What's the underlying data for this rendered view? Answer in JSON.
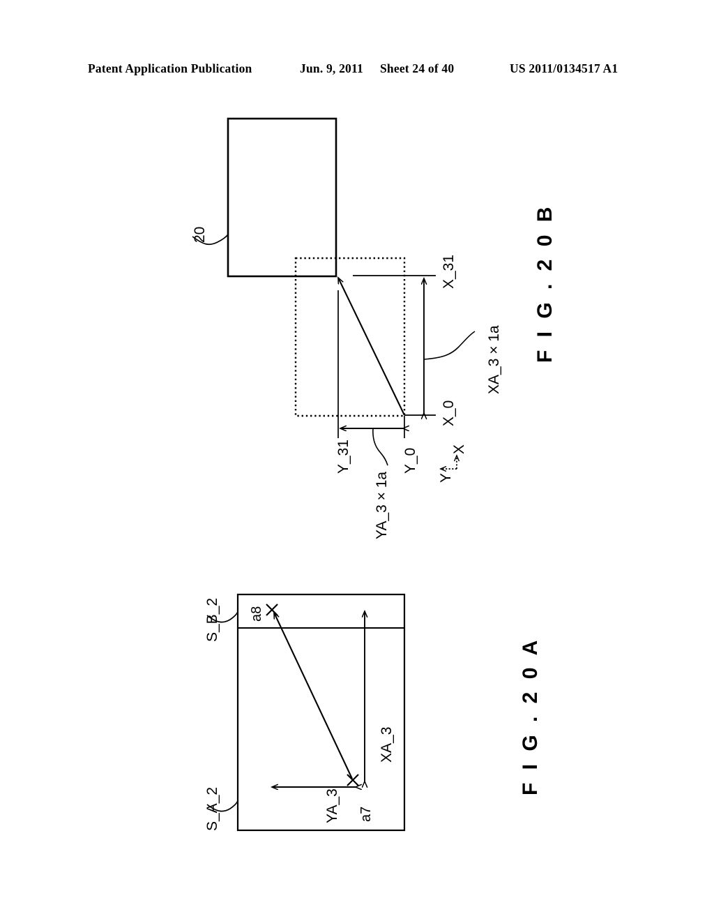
{
  "header": {
    "publication": "Patent Application Publication",
    "date": "Jun. 9, 2011",
    "sheet": "Sheet 24 of 40",
    "number": "US 2011/0134517 A1"
  },
  "figures": [
    {
      "caption": "F I G .  2 0 B",
      "labels": {
        "ref_20": "20",
        "x_31": "X_31",
        "x_0": "X_0",
        "xa_3_1a": "XA_3 × 1a",
        "y_31": "Y_31",
        "y_0": "Y_0",
        "ya_3_1a": "YA_3 × 1a",
        "axis_x": "X",
        "axis_y": "Y"
      }
    },
    {
      "caption": "F I G .  2 0 A",
      "labels": {
        "s_b_2": "S_B_2",
        "s_a_2": "S_A_2",
        "a8": "a8",
        "a7": "a7",
        "xa_3": "XA_3",
        "ya_3": "YA_3",
        "marker_a8": "X",
        "marker_a7": "X"
      }
    }
  ],
  "colors": {
    "ink": "#000000",
    "paper": "#ffffff"
  }
}
